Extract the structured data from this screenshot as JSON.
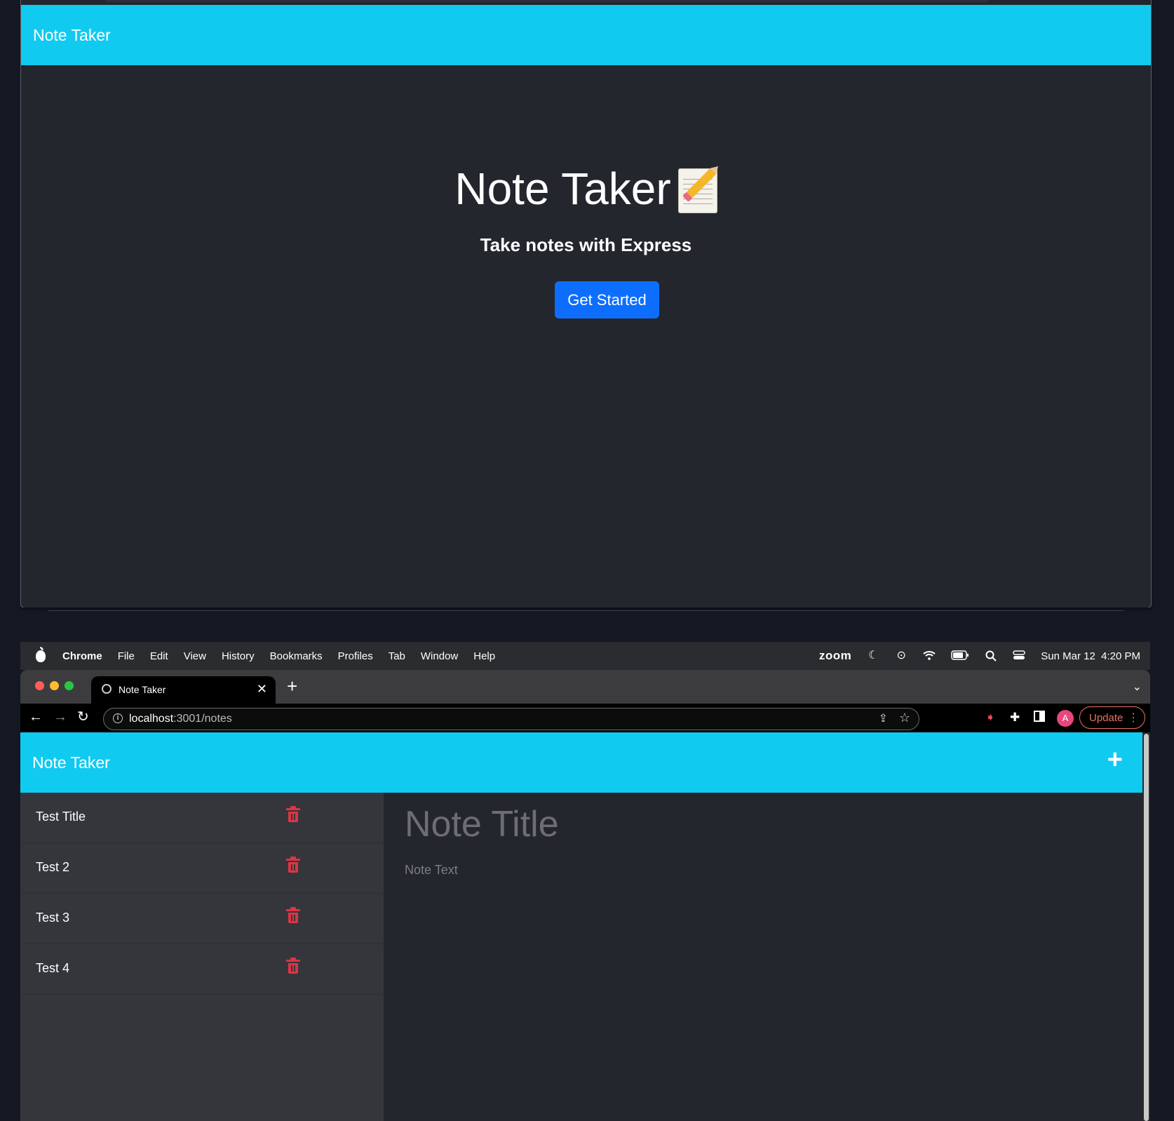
{
  "landing": {
    "brand": "Note Taker",
    "hero_title": "Note Taker",
    "hero_emoji": "memo-icon",
    "hero_subtitle": "Take notes with Express",
    "cta_label": "Get Started"
  },
  "menubar": {
    "app_name": "Chrome",
    "items": [
      "File",
      "Edit",
      "View",
      "History",
      "Bookmarks",
      "Profiles",
      "Tab",
      "Window",
      "Help"
    ],
    "zoom_label": "zoom",
    "datetime": "Sun Mar 12  4:20 PM"
  },
  "browser": {
    "tab_title": "Note Taker",
    "url_host": "localhost",
    "url_path": ":3001/notes",
    "profile_initial": "A",
    "update_label": "Update"
  },
  "app": {
    "brand": "Note Taker",
    "notes": [
      {
        "title": "Test Title"
      },
      {
        "title": "Test 2"
      },
      {
        "title": "Test 3"
      },
      {
        "title": "Test 4"
      }
    ],
    "title_placeholder": "Note Title",
    "text_placeholder": "Note Text"
  },
  "colors": {
    "navbar": "#11caf0",
    "primary_button": "#0d6efd",
    "delete_icon": "#dc3545",
    "background": "#23262d",
    "sidebar": "#34363b"
  }
}
